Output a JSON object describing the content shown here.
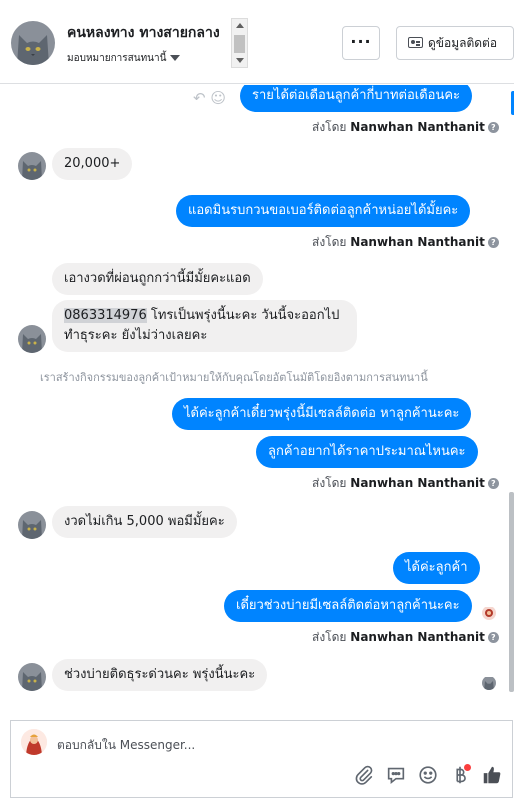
{
  "header": {
    "contact_name": "คนหลงทาง ทางสายกลาง",
    "assign_label": "มอบหมายการสนทนานี้",
    "more_label": "···",
    "contact_info_label": "ดูข้อมูลติดต่อ"
  },
  "messages": [
    {
      "text": "รายได้ต่อเดือนลูกค้ากี่บาทต่อเดือนคะ",
      "from": "page"
    },
    {
      "text": "20,000+",
      "from": "customer"
    },
    {
      "text": "แอดมินรบกวนขอเบอร์ติดต่อลูกค้าหน่อยได้มั้ยคะ",
      "from": "page"
    },
    {
      "text": "เอางวดที่ผ่อนถูกกว่านี้มีมั้ยคะแอด",
      "from": "customer"
    },
    {
      "phone": "0863314976",
      "text_line1": " โทรเป็นพรุ่งนี้นะคะ วันนี้จะออกไป",
      "text_line2": "ทำธุระคะ ยังไม่ว่างเลยคะ",
      "from": "customer"
    },
    {
      "text": "ได้ค่ะลูกค้าเดี๋ยวพรุ่งนี้มีเซลล์ติดต่อ หาลูกค้านะคะ",
      "from": "page"
    },
    {
      "text": "ลูกค้าอยากได้ราคาประมาณไหนคะ",
      "from": "page"
    },
    {
      "text": "งวดไม่เกิน 5,000 พอมีมั้ยคะ",
      "from": "customer"
    },
    {
      "text": "ได้ค่ะลูกค้า",
      "from": "page"
    },
    {
      "text": "เดี๋ยวช่วงบ่ายมีเซลล์ติดต่อหาลูกค้านะคะ",
      "from": "page"
    },
    {
      "text": "ช่วงบ่ายติดธุระด่วนคะ พรุ่งนี้นะคะ",
      "from": "customer"
    }
  ],
  "sent_by": {
    "prefix": "ส่งโดย",
    "name": "Nanwhan Nanthanit",
    "help": "?"
  },
  "system_note": "เราสร้างกิจกรรมของลูกค้าเป้าหมายให้กับคุณโดยอัตโนมัติโดยอิงตามการสนทนานี้",
  "composer": {
    "placeholder": "ตอบกลับใน Messenger..."
  },
  "colors": {
    "accent": "#0084ff",
    "incoming_bubble": "#f1f0f0",
    "badge": "#fa3e3e"
  },
  "icons": [
    "paperclip-icon",
    "message-icon",
    "smile-icon",
    "baht-icon",
    "thumbs-up-icon"
  ]
}
